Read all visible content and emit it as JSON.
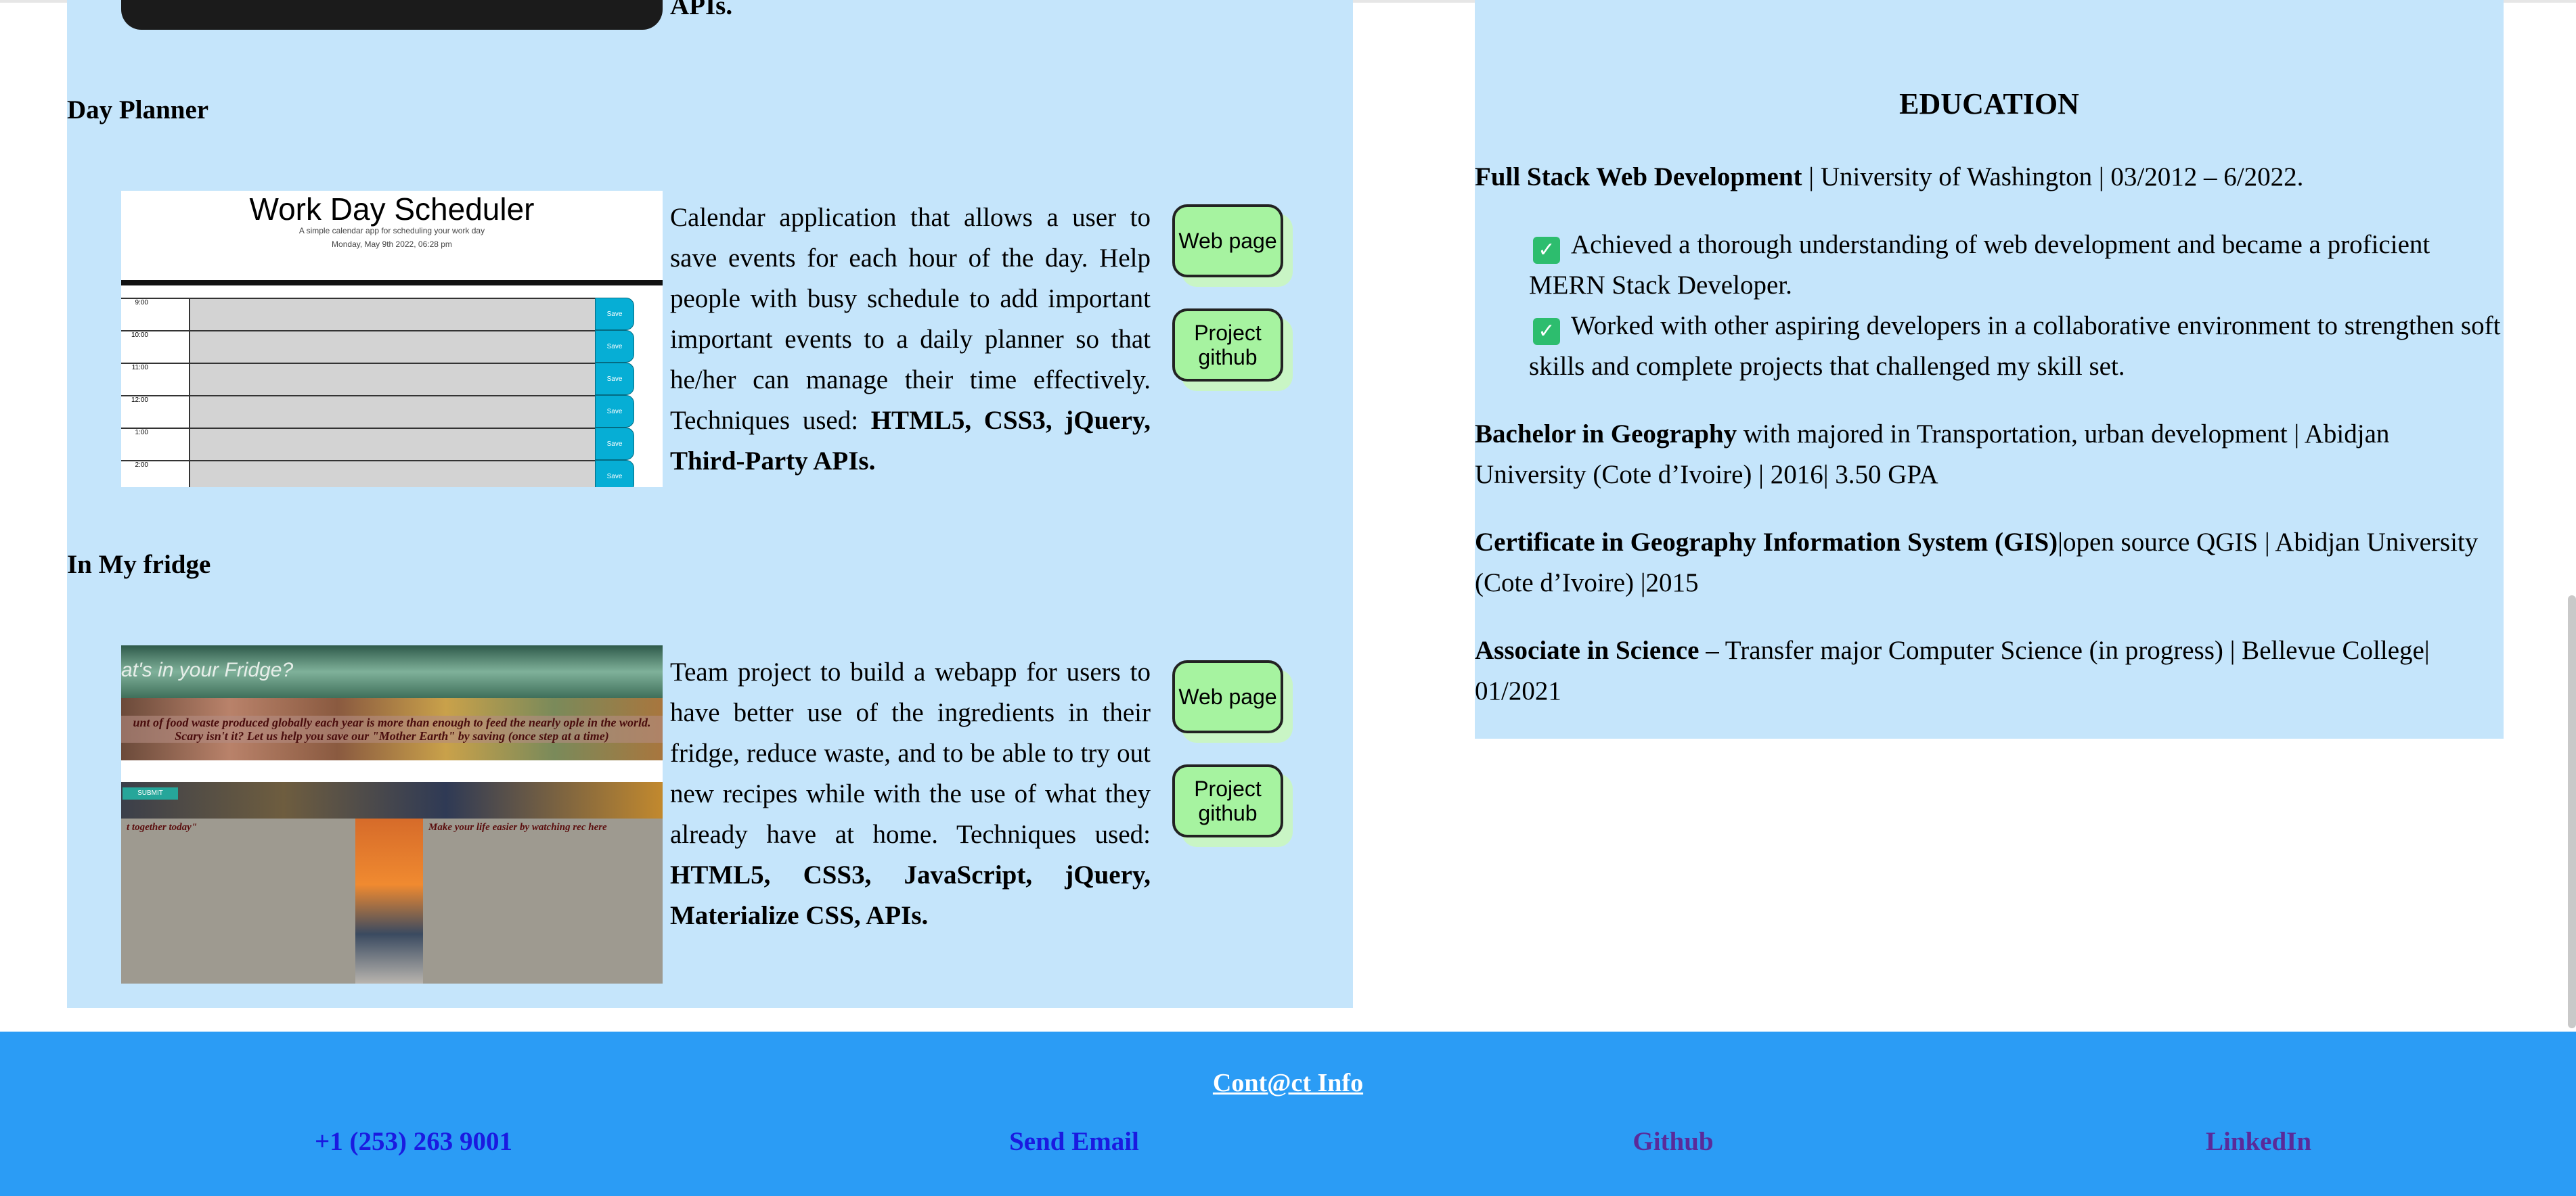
{
  "projects": [
    {
      "title": "Day Planner",
      "description": "Calendar application that allows a user to save events for each hour of the day. Help people with busy schedule to add important important events to a daily planner so that he/her can manage their time effectively.",
      "techniques_label": "Techniques used:",
      "techniques": "HTML5, CSS3, jQuery, Third-Party APIs.",
      "web_button": "Web page",
      "github_button": "Project github",
      "screenshot": {
        "title": "Work Day Scheduler",
        "subtitle": "A simple calendar app for scheduling your work day",
        "date": "Monday, May 9th 2022, 06:28 pm",
        "hours": [
          "9:00",
          "10:00",
          "11:00",
          "12:00",
          "1:00",
          "2:00"
        ],
        "save_label": "Save"
      }
    },
    {
      "title": "In My fridge",
      "description": "Team project to build a webapp for users to have better use of the ingredients in their fridge, reduce waste, and to be able to try out new recipes while with the use of what they already have at home.",
      "techniques_label": "Techniques used:",
      "techniques": "HTML5, CSS3, JavaScript, jQuery, Materialize CSS, APIs.",
      "web_button": "Web page",
      "github_button": "Project github",
      "screenshot": {
        "heading": "at's in your Fridge?",
        "banner": "unt of food waste produced globally each year is more than enough to feed the nearly ople in the world. Scary isn't it? Let us help you save our \"Mother Earth\" by saving (once step at a time)",
        "submit": "SUBMIT",
        "card_left": "t together today\"",
        "card_right": "Make your life easier by watching rec here"
      }
    }
  ],
  "previous_tail": "APIs.",
  "education": {
    "title": "EDUCATION",
    "entries": [
      {
        "bold": "Full Stack Web Development",
        "rest": " | University of Washington | 03/2012 – 6/2022."
      },
      {
        "bold": "Bachelor in Geography",
        "rest": " with majored in Transportation, urban development | Abidjan University (Cote d’Ivoire) | 2016| 3.50 GPA"
      },
      {
        "bold": "Certificate in Geography Information System (GIS)",
        "rest": "|open source QGIS | Abidjan University (Cote d’Ivoire) |2015"
      },
      {
        "bold": "Associate in Science",
        "rest": " – Transfer major Computer Science (in progress) | Bellevue College| 01/2021"
      }
    ],
    "bullets": [
      "Achieved a thorough understanding of web development and became a proficient MERN Stack Developer.",
      "Worked with other aspiring developers in a collaborative environment to strengthen soft skills and complete projects that challenged my skill set."
    ],
    "bullet_icon": "check-box-icon"
  },
  "footer": {
    "title": "Cont@ct Info",
    "phone": "+1 (253) 263 9001",
    "email": "Send Email",
    "github": "Github",
    "linkedin": "LinkedIn",
    "background": "#2b9cf5"
  },
  "colors": {
    "panel": "#c5e5fb",
    "button": "#a6f3a0",
    "link_blue": "#1a1ae0",
    "link_visited": "#5a2a9a"
  }
}
